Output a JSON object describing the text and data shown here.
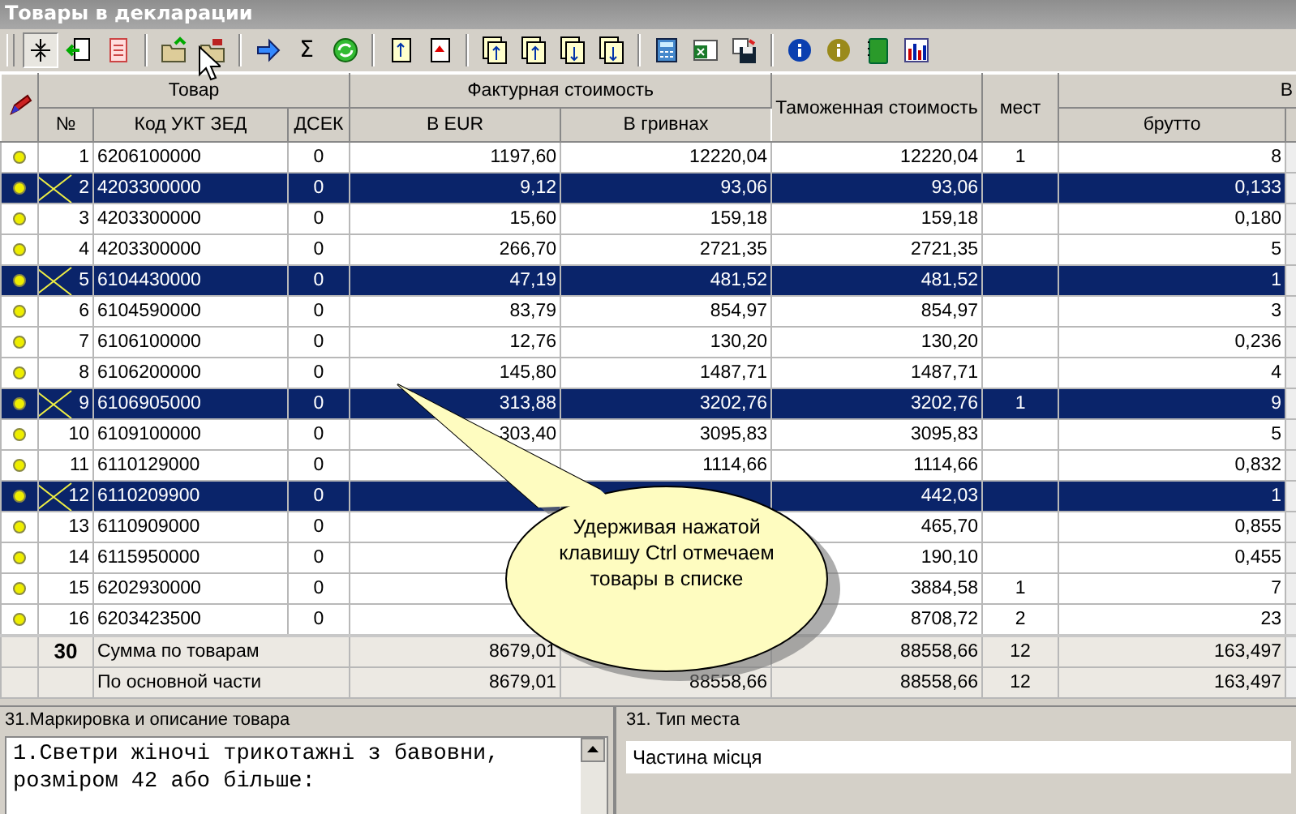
{
  "window": {
    "title": "Товары в декларации"
  },
  "toolbar": {
    "sum_label": "Σ"
  },
  "table": {
    "group_headers": {
      "goods": "Товар",
      "invoice": "Фактурная стоимость",
      "customs": "Таможенная стоимость",
      "places": "мест",
      "weight": "В"
    },
    "columns": {
      "n": "№",
      "code": "Код УКТ ЗЕД",
      "dsek": "ДСЕК",
      "eur": "В EUR",
      "uah": "В гривнах",
      "gross": "брутто"
    },
    "rows": [
      {
        "n": "1",
        "code": "6206100000",
        "dsek": "0",
        "eur": "1197,60",
        "uah": "12220,04",
        "customs": "12220,04",
        "places": "1",
        "gross": "8",
        "selected": false
      },
      {
        "n": "2",
        "code": "4203300000",
        "dsek": "0",
        "eur": "9,12",
        "uah": "93,06",
        "customs": "93,06",
        "gross": "0,133",
        "selected": true
      },
      {
        "n": "3",
        "code": "4203300000",
        "dsek": "0",
        "eur": "15,60",
        "uah": "159,18",
        "customs": "159,18",
        "gross": "0,180",
        "selected": false
      },
      {
        "n": "4",
        "code": "4203300000",
        "dsek": "0",
        "eur": "266,70",
        "uah": "2721,35",
        "customs": "2721,35",
        "gross": "5",
        "selected": false
      },
      {
        "n": "5",
        "code": "6104430000",
        "dsek": "0",
        "eur": "47,19",
        "uah": "481,52",
        "customs": "481,52",
        "gross": "1",
        "selected": true
      },
      {
        "n": "6",
        "code": "6104590000",
        "dsek": "0",
        "eur": "83,79",
        "uah": "854,97",
        "customs": "854,97",
        "gross": "3",
        "selected": false
      },
      {
        "n": "7",
        "code": "6106100000",
        "dsek": "0",
        "eur": "12,76",
        "uah": "130,20",
        "customs": "130,20",
        "gross": "0,236",
        "selected": false
      },
      {
        "n": "8",
        "code": "6106200000",
        "dsek": "0",
        "eur": "145,80",
        "uah": "1487,71",
        "customs": "1487,71",
        "gross": "4",
        "selected": false
      },
      {
        "n": "9",
        "code": "6106905000",
        "dsek": "0",
        "eur": "313,88",
        "uah": "3202,76",
        "customs": "3202,76",
        "places": "1",
        "gross": "9",
        "selected": true
      },
      {
        "n": "10",
        "code": "6109100000",
        "dsek": "0",
        "eur": "303,40",
        "uah": "3095,83",
        "customs": "3095,83",
        "gross": "5",
        "selected": false
      },
      {
        "n": "11",
        "code": "6110129000",
        "dsek": "0",
        "uah": "1114,66",
        "customs": "1114,66",
        "gross": "0,832",
        "selected": false
      },
      {
        "n": "12",
        "code": "6110209900",
        "dsek": "0",
        "customs": "442,03",
        "gross": "1",
        "selected": true
      },
      {
        "n": "13",
        "code": "6110909000",
        "dsek": "0",
        "customs": "465,70",
        "gross": "0,855",
        "selected": false
      },
      {
        "n": "14",
        "code": "6115950000",
        "dsek": "0",
        "customs": "190,10",
        "gross": "0,455",
        "selected": false
      },
      {
        "n": "15",
        "code": "6202930000",
        "dsek": "0",
        "customs": "3884,58",
        "places": "1",
        "gross": "7",
        "selected": false
      },
      {
        "n": "16",
        "code": "6203423500",
        "dsek": "0",
        "customs": "8708,72",
        "places": "2",
        "gross": "23",
        "selected": false
      }
    ],
    "totals": [
      {
        "count": "30",
        "label": "Сумма по товарам",
        "eur": "8679,01",
        "customs": "88558,66",
        "places": "12",
        "gross": "163,497"
      },
      {
        "label": "По основной части",
        "eur": "8679,01",
        "uah": "88558,66",
        "customs": "88558,66",
        "places": "12",
        "gross": "163,497"
      }
    ]
  },
  "callout": {
    "text": "Удерживая нажатой клавишу Ctrl отмечаем товары в списке"
  },
  "description_panel": {
    "title": "31.Маркировка и описание товара",
    "lines": [
      "1.Светри жіночі трикотажні з бавовни,",
      "розміром 42 або більше:"
    ]
  },
  "place_panel": {
    "title": "31. Тип места",
    "value": "Частина місця"
  }
}
